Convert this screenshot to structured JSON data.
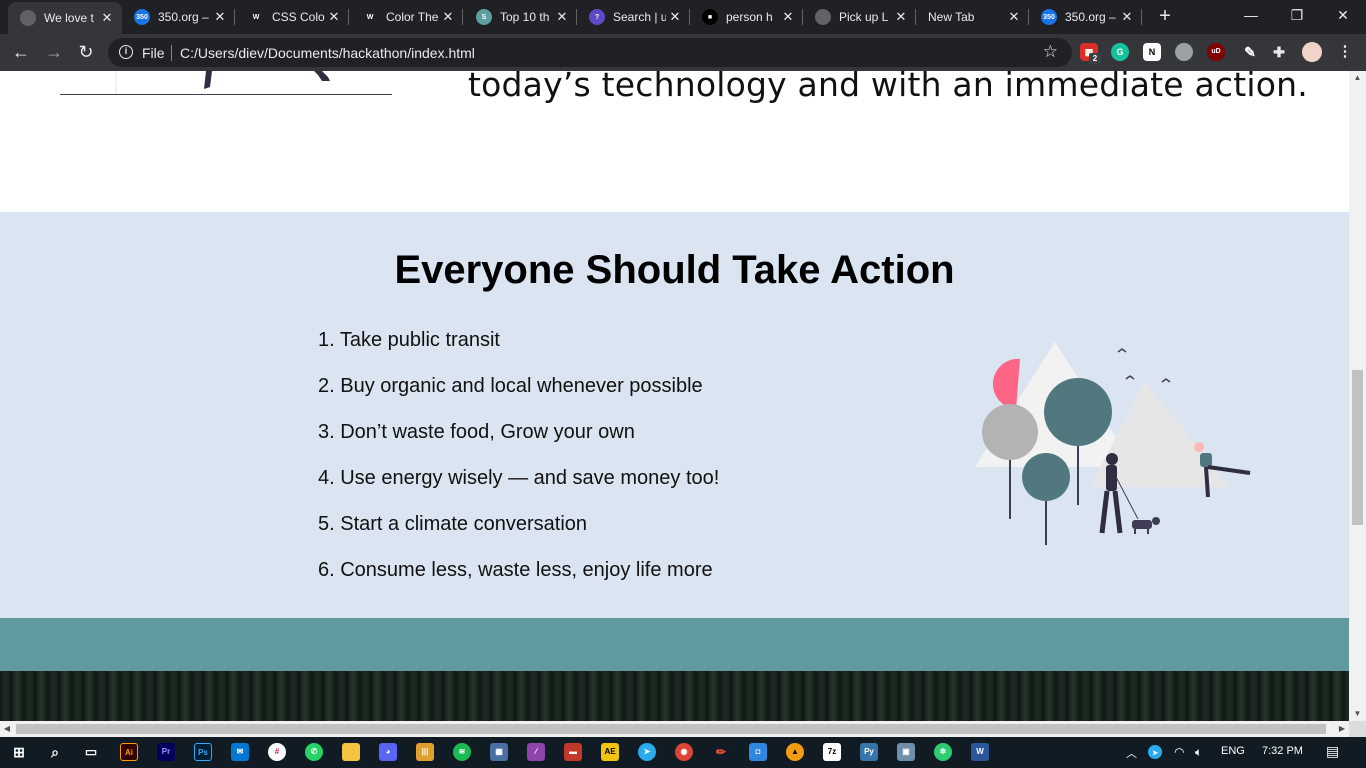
{
  "browser": {
    "tabs": [
      {
        "title": "We love t",
        "active": true,
        "favicon_color": "#5f6368",
        "favicon_text": ""
      },
      {
        "title": "350.org –",
        "active": false,
        "favicon_color": "#1a73e8",
        "favicon_text": "350"
      },
      {
        "title": "CSS Colo",
        "active": false,
        "favicon_color": "#202124",
        "favicon_text": "W"
      },
      {
        "title": "Color The",
        "active": false,
        "favicon_color": "#202124",
        "favicon_text": "W"
      },
      {
        "title": "Top 10 th",
        "active": false,
        "favicon_color": "#5f9ea0",
        "favicon_text": "S"
      },
      {
        "title": "Search | u",
        "active": false,
        "favicon_color": "#5b4bc4",
        "favicon_text": "?"
      },
      {
        "title": "person h",
        "active": false,
        "favicon_color": "#000000",
        "favicon_text": "■"
      },
      {
        "title": "Pick up L",
        "active": false,
        "favicon_color": "#5f6368",
        "favicon_text": ""
      },
      {
        "title": "New Tab",
        "active": false,
        "favicon_color": "",
        "favicon_text": ""
      },
      {
        "title": "350.org –",
        "active": false,
        "favicon_color": "#1a73e8",
        "favicon_text": "350"
      }
    ],
    "address": {
      "scheme_label": "File",
      "url": "C:/Users/diev/Documents/hackathon/index.html"
    },
    "extensions_badge": "2"
  },
  "page": {
    "hero_text": "today’s technology and with an immediate action.",
    "action_heading": "Everyone Should Take Action",
    "action_items": [
      "1. Take public transit",
      "2. Buy organic and local whenever possible",
      "3. Don’t waste food, Grow your own",
      "4. Use energy wisely — and save money too!",
      "5. Start a climate conversation",
      "6. Consume less, waste less, enjoy life more"
    ],
    "colors": {
      "action_bg": "#dae5f1",
      "teal_band": "#609a9e",
      "tree_teal": "#52787f",
      "sun_pink": "#ff6584"
    }
  },
  "taskbar": {
    "language": "ENG",
    "time": "7:32 PM"
  }
}
